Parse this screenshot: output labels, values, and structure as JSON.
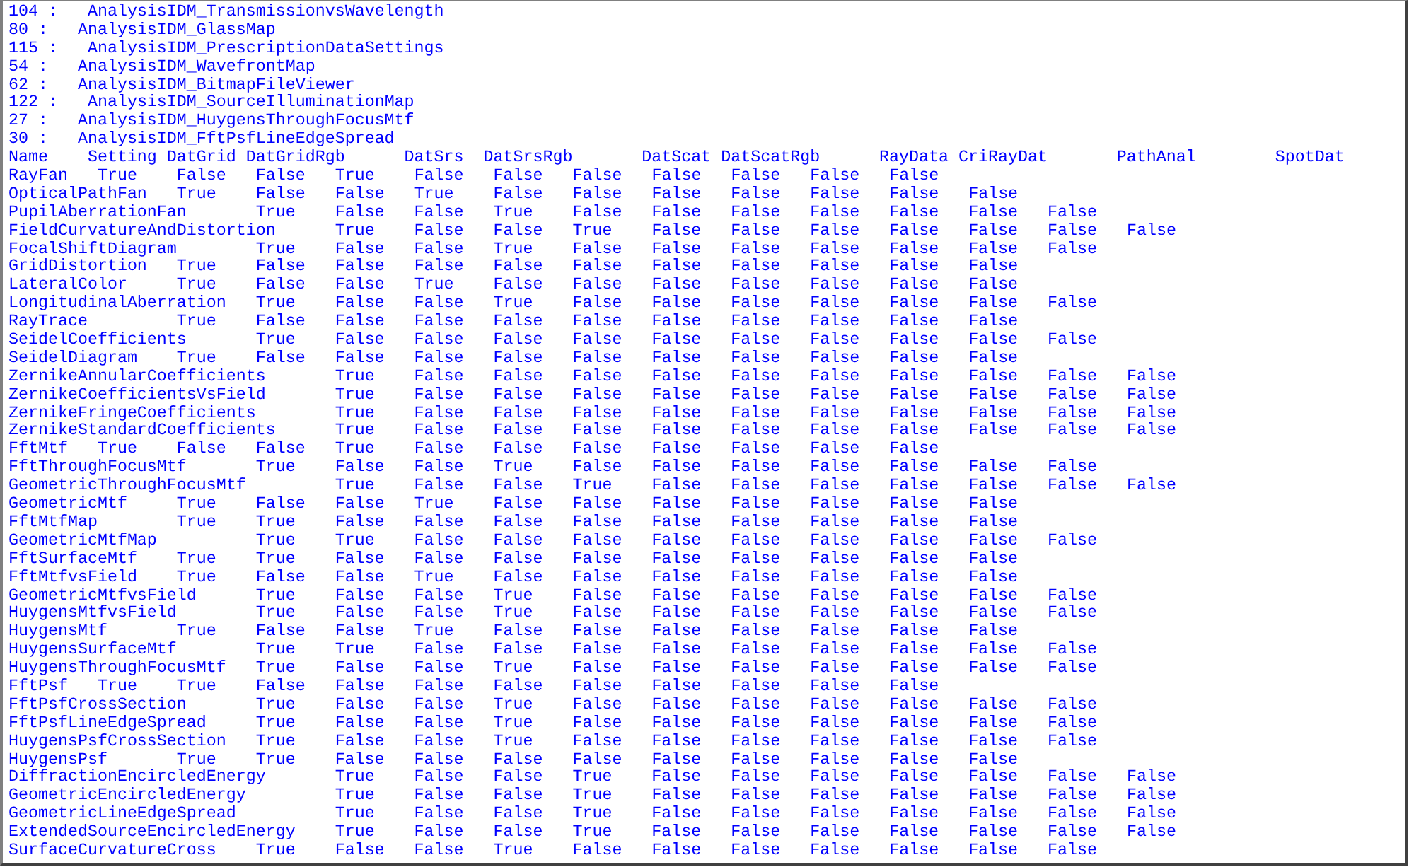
{
  "analysis_list": [
    {
      "number": "104 :",
      "name": "AnalysisIDM_TransmissionvsWavelength"
    },
    {
      "number": "80 :",
      "name": "AnalysisIDM_GlassMap"
    },
    {
      "number": "115 :",
      "name": "AnalysisIDM_PrescriptionDataSettings"
    },
    {
      "number": "54 :",
      "name": "AnalysisIDM_WavefrontMap"
    },
    {
      "number": "62 :",
      "name": "AnalysisIDM_BitmapFileViewer"
    },
    {
      "number": "122 :",
      "name": "AnalysisIDM_SourceIlluminationMap"
    },
    {
      "number": "27 :",
      "name": "AnalysisIDM_HuygensThroughFocusMtf"
    },
    {
      "number": "30 :",
      "name": "AnalysisIDM_FftPsfLineEdgeSpread"
    }
  ],
  "table": {
    "columns": [
      "Name",
      "Setting",
      "DatGrid",
      "DatGridRgb",
      "DatSrs",
      "DatSrsRgb",
      "DatScat",
      "DatScatRgb",
      "RayData",
      "CriRayDat",
      "PathAnal",
      "SpotDat"
    ],
    "rows": [
      {
        "name": "RayFan",
        "values": [
          "True",
          "False",
          "False",
          "True",
          "False",
          "False",
          "False",
          "False",
          "False",
          "False",
          "False"
        ]
      },
      {
        "name": "OpticalPathFan",
        "values": [
          "True",
          "False",
          "False",
          "True",
          "False",
          "False",
          "False",
          "False",
          "False",
          "False",
          "False"
        ]
      },
      {
        "name": "PupilAberrationFan",
        "values": [
          "True",
          "False",
          "False",
          "True",
          "False",
          "False",
          "False",
          "False",
          "False",
          "False",
          "False"
        ]
      },
      {
        "name": "FieldCurvatureAndDistortion",
        "values": [
          "True",
          "False",
          "False",
          "True",
          "False",
          "False",
          "False",
          "False",
          "False",
          "False",
          "False"
        ]
      },
      {
        "name": "FocalShiftDiagram",
        "values": [
          "True",
          "False",
          "False",
          "True",
          "False",
          "False",
          "False",
          "False",
          "False",
          "False",
          "False"
        ]
      },
      {
        "name": "GridDistortion",
        "values": [
          "True",
          "False",
          "False",
          "False",
          "False",
          "False",
          "False",
          "False",
          "False",
          "False",
          "False"
        ]
      },
      {
        "name": "LateralColor",
        "values": [
          "True",
          "False",
          "False",
          "True",
          "False",
          "False",
          "False",
          "False",
          "False",
          "False",
          "False"
        ]
      },
      {
        "name": "LongitudinalAberration",
        "values": [
          "True",
          "False",
          "False",
          "True",
          "False",
          "False",
          "False",
          "False",
          "False",
          "False",
          "False"
        ]
      },
      {
        "name": "RayTrace",
        "values": [
          "True",
          "False",
          "False",
          "False",
          "False",
          "False",
          "False",
          "False",
          "False",
          "False",
          "False"
        ]
      },
      {
        "name": "SeidelCoefficients",
        "values": [
          "True",
          "False",
          "False",
          "False",
          "False",
          "False",
          "False",
          "False",
          "False",
          "False",
          "False"
        ]
      },
      {
        "name": "SeidelDiagram",
        "values": [
          "True",
          "False",
          "False",
          "False",
          "False",
          "False",
          "False",
          "False",
          "False",
          "False",
          "False"
        ]
      },
      {
        "name": "ZernikeAnnularCoefficients",
        "values": [
          "True",
          "False",
          "False",
          "False",
          "False",
          "False",
          "False",
          "False",
          "False",
          "False",
          "False"
        ]
      },
      {
        "name": "ZernikeCoefficientsVsField",
        "values": [
          "True",
          "False",
          "False",
          "False",
          "False",
          "False",
          "False",
          "False",
          "False",
          "False",
          "False"
        ]
      },
      {
        "name": "ZernikeFringeCoefficients",
        "values": [
          "True",
          "False",
          "False",
          "False",
          "False",
          "False",
          "False",
          "False",
          "False",
          "False",
          "False"
        ]
      },
      {
        "name": "ZernikeStandardCoefficients",
        "values": [
          "True",
          "False",
          "False",
          "False",
          "False",
          "False",
          "False",
          "False",
          "False",
          "False",
          "False"
        ]
      },
      {
        "name": "FftMtf",
        "values": [
          "True",
          "False",
          "False",
          "True",
          "False",
          "False",
          "False",
          "False",
          "False",
          "False",
          "False"
        ]
      },
      {
        "name": "FftThroughFocusMtf",
        "values": [
          "True",
          "False",
          "False",
          "True",
          "False",
          "False",
          "False",
          "False",
          "False",
          "False",
          "False"
        ]
      },
      {
        "name": "GeometricThroughFocusMtf",
        "values": [
          "True",
          "False",
          "False",
          "True",
          "False",
          "False",
          "False",
          "False",
          "False",
          "False",
          "False"
        ]
      },
      {
        "name": "GeometricMtf",
        "values": [
          "True",
          "False",
          "False",
          "True",
          "False",
          "False",
          "False",
          "False",
          "False",
          "False",
          "False"
        ]
      },
      {
        "name": "FftMtfMap",
        "values": [
          "True",
          "True",
          "False",
          "False",
          "False",
          "False",
          "False",
          "False",
          "False",
          "False",
          "False"
        ]
      },
      {
        "name": "GeometricMtfMap",
        "values": [
          "True",
          "True",
          "False",
          "False",
          "False",
          "False",
          "False",
          "False",
          "False",
          "False",
          "False"
        ]
      },
      {
        "name": "FftSurfaceMtf",
        "values": [
          "True",
          "True",
          "False",
          "False",
          "False",
          "False",
          "False",
          "False",
          "False",
          "False",
          "False"
        ]
      },
      {
        "name": "FftMtfvsField",
        "values": [
          "True",
          "False",
          "False",
          "True",
          "False",
          "False",
          "False",
          "False",
          "False",
          "False",
          "False"
        ]
      },
      {
        "name": "GeometricMtfvsField",
        "values": [
          "True",
          "False",
          "False",
          "True",
          "False",
          "False",
          "False",
          "False",
          "False",
          "False",
          "False"
        ]
      },
      {
        "name": "HuygensMtfvsField",
        "values": [
          "True",
          "False",
          "False",
          "True",
          "False",
          "False",
          "False",
          "False",
          "False",
          "False",
          "False"
        ]
      },
      {
        "name": "HuygensMtf",
        "values": [
          "True",
          "False",
          "False",
          "True",
          "False",
          "False",
          "False",
          "False",
          "False",
          "False",
          "False"
        ]
      },
      {
        "name": "HuygensSurfaceMtf",
        "values": [
          "True",
          "True",
          "False",
          "False",
          "False",
          "False",
          "False",
          "False",
          "False",
          "False",
          "False"
        ]
      },
      {
        "name": "HuygensThroughFocusMtf",
        "values": [
          "True",
          "False",
          "False",
          "True",
          "False",
          "False",
          "False",
          "False",
          "False",
          "False",
          "False"
        ]
      },
      {
        "name": "FftPsf",
        "values": [
          "True",
          "True",
          "False",
          "False",
          "False",
          "False",
          "False",
          "False",
          "False",
          "False",
          "False"
        ]
      },
      {
        "name": "FftPsfCrossSection",
        "values": [
          "True",
          "False",
          "False",
          "True",
          "False",
          "False",
          "False",
          "False",
          "False",
          "False",
          "False"
        ]
      },
      {
        "name": "FftPsfLineEdgeSpread",
        "values": [
          "True",
          "False",
          "False",
          "True",
          "False",
          "False",
          "False",
          "False",
          "False",
          "False",
          "False"
        ]
      },
      {
        "name": "HuygensPsfCrossSection",
        "values": [
          "True",
          "False",
          "False",
          "True",
          "False",
          "False",
          "False",
          "False",
          "False",
          "False",
          "False"
        ]
      },
      {
        "name": "HuygensPsf",
        "values": [
          "True",
          "True",
          "False",
          "False",
          "False",
          "False",
          "False",
          "False",
          "False",
          "False",
          "False"
        ]
      },
      {
        "name": "DiffractionEncircledEnergy",
        "values": [
          "True",
          "False",
          "False",
          "True",
          "False",
          "False",
          "False",
          "False",
          "False",
          "False",
          "False"
        ]
      },
      {
        "name": "GeometricEncircledEnergy",
        "values": [
          "True",
          "False",
          "False",
          "True",
          "False",
          "False",
          "False",
          "False",
          "False",
          "False",
          "False"
        ]
      },
      {
        "name": "GeometricLineEdgeSpread",
        "values": [
          "True",
          "False",
          "False",
          "True",
          "False",
          "False",
          "False",
          "False",
          "False",
          "False",
          "False"
        ]
      },
      {
        "name": "ExtendedSourceEncircledEnergy",
        "values": [
          "True",
          "False",
          "False",
          "True",
          "False",
          "False",
          "False",
          "False",
          "False",
          "False",
          "False"
        ]
      },
      {
        "name": "SurfaceCurvatureCross",
        "values": [
          "True",
          "False",
          "False",
          "True",
          "False",
          "False",
          "False",
          "False",
          "False",
          "False",
          "False"
        ]
      }
    ]
  }
}
